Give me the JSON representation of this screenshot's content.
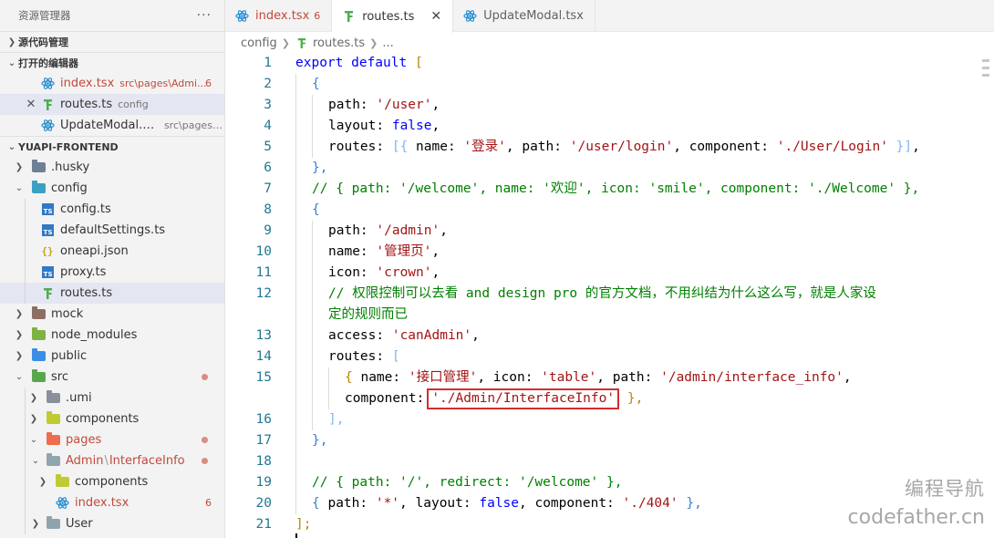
{
  "explorer": {
    "title": "资源管理器",
    "more": "···",
    "scm_section": "源代码管理",
    "open_editors_section": "打开的编辑器",
    "open_editors": [
      {
        "name": "index.tsx",
        "desc": "src\\pages\\Admi...",
        "badge": "6"
      },
      {
        "name": "routes.ts",
        "desc": "config",
        "close": "✕"
      },
      {
        "name": "UpdateModal.tsx",
        "desc": "src\\pages\\..."
      }
    ],
    "project_section": "YUAPI-FRONTEND",
    "tree": {
      "husky": ".husky",
      "config": "config",
      "config_ts": "config.ts",
      "default_settings": "defaultSettings.ts",
      "oneapi": "oneapi.json",
      "proxy": "proxy.ts",
      "routes": "routes.ts",
      "mock": "mock",
      "node_modules": "node_modules",
      "public": "public",
      "src": "src",
      "umi": ".umi",
      "components": "components",
      "pages": "pages",
      "admin_path": "Admin",
      "admin_sub": "InterfaceInfo",
      "admin_components": "components",
      "index_tsx": "index.tsx",
      "index_badge": "6",
      "user": "User"
    }
  },
  "tabs": [
    {
      "label": "index.tsx",
      "badge": "6"
    },
    {
      "label": "routes.ts",
      "close": "✕"
    },
    {
      "label": "UpdateModal.tsx"
    }
  ],
  "breadcrumb": {
    "folder": "config",
    "file": "routes.ts",
    "tail": "..."
  },
  "editor": {
    "line_numbers": [
      "1",
      "2",
      "3",
      "4",
      "5",
      "6",
      "7",
      "8",
      "9",
      "10",
      "11",
      "12",
      "",
      "13",
      "14",
      "15",
      "",
      "16",
      "17",
      "18",
      "19",
      "20",
      "21"
    ],
    "code": {
      "l1_kw": "export default",
      "l1_br": "[",
      "l2": "{",
      "l3_key": "path: ",
      "l3_val": "'/user'",
      "l4_key": "layout: ",
      "l4_val": "false",
      "l5_key": "routes: ",
      "l5_br": "[{",
      "l5_a": " name: ",
      "l5_name": "'登录'",
      "l5_b": ", path: ",
      "l5_path": "'/user/login'",
      "l5_c": ", component: ",
      "l5_comp": "'./User/Login'",
      "l5_end": " }]",
      "l6": "},",
      "l7": "// { path: '/welcome', name: '欢迎', icon: 'smile', component: './Welcome' },",
      "l8": "{",
      "l9_key": "path: ",
      "l9_val": "'/admin'",
      "l10_key": "name: ",
      "l10_val": "'管理页'",
      "l11_key": "icon: ",
      "l11_val": "'crown'",
      "l12a": "// 权限控制可以去看 and design pro 的官方文档，不用纠结为什么这么写，就是人家设",
      "l12b": "定的规则而已",
      "l13_key": "access: ",
      "l13_val": "'canAdmin'",
      "l14_key": "routes: ",
      "l14_br": "[",
      "l15_br": "{",
      "l15_a": " name: ",
      "l15_name": "'接口管理'",
      "l15_b": ", icon: ",
      "l15_icon": "'table'",
      "l15_c": ", path: ",
      "l15_path": "'/admin/interface_info'",
      "l15_d": ",",
      "l15w_key": "component:",
      "l15w_val": "'./Admin/InterfaceInfo'",
      "l15w_end": " },",
      "l16": "],",
      "l17": "},",
      "l19": "// { path: '/', redirect: '/welcome' },",
      "l20_br": "{",
      "l20_a": " path: ",
      "l20_path": "'*'",
      "l20_b": ", layout: ",
      "l20_layout": "false",
      "l20_c": ", component: ",
      "l20_comp": "'./404'",
      "l20_end": " },",
      "l21": "];"
    }
  },
  "watermark": {
    "line1": "编程导航",
    "line2": "codefather.cn"
  },
  "colors": {
    "keyword": "#0000ff",
    "string": "#a31515",
    "comment": "#008000",
    "line_number": "#237893",
    "highlight_box": "#d22d2d"
  }
}
